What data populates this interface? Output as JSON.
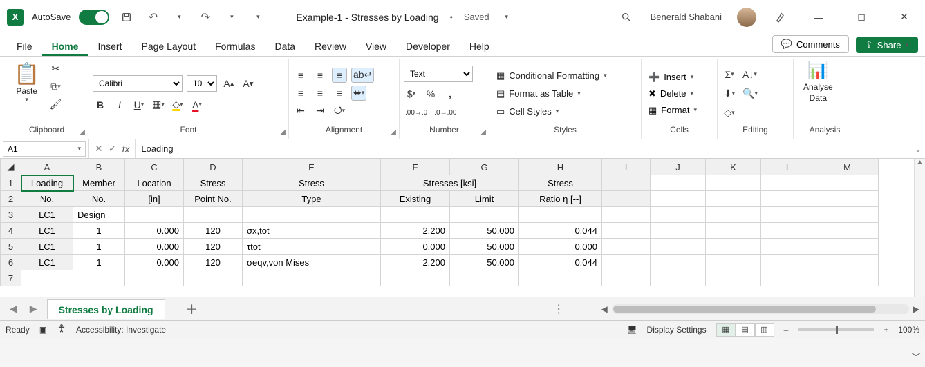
{
  "title": {
    "autosave_label": "AutoSave",
    "doc_name": "Example-1 - Stresses by Loading",
    "saved_state": "Saved",
    "user_name": "Benerald Shabani"
  },
  "menu": {
    "file": "File",
    "home": "Home",
    "insert": "Insert",
    "page_layout": "Page Layout",
    "formulas": "Formulas",
    "data": "Data",
    "review": "Review",
    "view": "View",
    "developer": "Developer",
    "help": "Help",
    "comments": "Comments",
    "share": "Share"
  },
  "ribbon": {
    "clipboard": {
      "paste": "Paste",
      "label": "Clipboard"
    },
    "font": {
      "name": "Calibri",
      "size": "10",
      "label": "Font"
    },
    "alignment": {
      "label": "Alignment"
    },
    "number": {
      "format": "Text",
      "label": "Number"
    },
    "styles": {
      "cond": "Conditional Formatting",
      "table": "Format as Table",
      "cell": "Cell Styles",
      "label": "Styles"
    },
    "cells": {
      "insert": "Insert",
      "delete": "Delete",
      "format": "Format",
      "label": "Cells"
    },
    "editing": {
      "label": "Editing"
    },
    "analysis": {
      "analyse": "Analyse",
      "data": "Data",
      "label": "Analysis"
    }
  },
  "namebox": {
    "ref": "A1"
  },
  "formula": {
    "value": "Loading"
  },
  "columns": [
    "A",
    "B",
    "C",
    "D",
    "E",
    "F",
    "G",
    "H",
    "I",
    "J",
    "K",
    "L",
    "M"
  ],
  "rows": [
    "1",
    "2",
    "3",
    "4",
    "5",
    "6",
    "7"
  ],
  "headers": {
    "r1": {
      "A": "Loading",
      "B": "Member",
      "C": "Location",
      "D": "Stress",
      "E": "Stress",
      "F": "Stresses [ksi]",
      "G": "",
      "H": "Stress"
    },
    "r2": {
      "A": "No.",
      "B": "No.",
      "C": "[in]",
      "D": "Point No.",
      "E": "Type",
      "F": "Existing",
      "G": "Limit",
      "H": "Ratio η [--]"
    }
  },
  "data_rows": [
    {
      "A": "LC1",
      "B": "Design",
      "C": "",
      "D": "",
      "E": "",
      "F": "",
      "G": "",
      "H": ""
    },
    {
      "A": "LC1",
      "B": "1",
      "C": "0.000",
      "D": "120",
      "E": "σx,tot",
      "F": "2.200",
      "G": "50.000",
      "H": "0.044"
    },
    {
      "A": "LC1",
      "B": "1",
      "C": "0.000",
      "D": "120",
      "E": "τtot",
      "F": "0.000",
      "G": "50.000",
      "H": "0.000"
    },
    {
      "A": "LC1",
      "B": "1",
      "C": "0.000",
      "D": "120",
      "E": "σeqv,von Mises",
      "F": "2.200",
      "G": "50.000",
      "H": "0.044"
    }
  ],
  "sheets": {
    "active": "Stresses by Loading"
  },
  "status": {
    "ready": "Ready",
    "accessibility": "Accessibility: Investigate",
    "display": "Display Settings",
    "zoom": "100%"
  }
}
